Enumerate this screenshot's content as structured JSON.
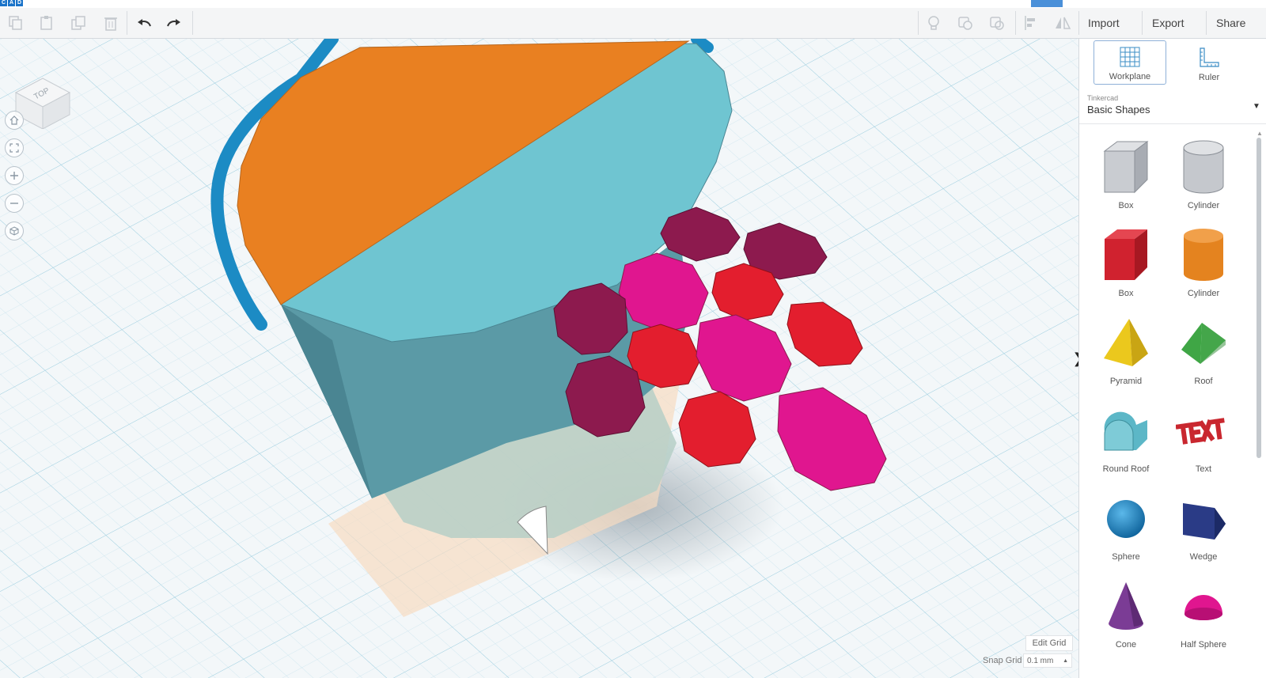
{
  "brand": {
    "logo_letters": [
      "C",
      "A",
      "D"
    ]
  },
  "toolbar": {
    "icons": [
      "copy-icon",
      "paste-icon",
      "duplicate-icon",
      "delete-icon",
      "undo-icon",
      "redo-icon",
      "note-icon",
      "group-icon",
      "ungroup-icon",
      "align-icon",
      "mirror-icon"
    ],
    "import_label": "Import",
    "export_label": "Export",
    "share_label": "Share"
  },
  "viewport": {
    "navcube_face_label": "TOP",
    "nav_controls": [
      "home-icon",
      "fit-view-icon",
      "zoom-in-icon",
      "zoom-out-icon",
      "perspective-icon"
    ],
    "edit_grid_label": "Edit Grid",
    "snap_grid_label": "Snap Grid",
    "snap_grid_value": "0.1 mm",
    "collapse_glyph": "❯"
  },
  "panel": {
    "tools": [
      {
        "label": "Workplane",
        "active": true
      },
      {
        "label": "Ruler",
        "active": false
      }
    ],
    "library_brand": "Tinkercad",
    "library_title": "Basic Shapes",
    "shapes": [
      {
        "label": "Box",
        "color": "#b9bdc4"
      },
      {
        "label": "Cylinder",
        "color": "#b9bdc4"
      },
      {
        "label": "Box",
        "color": "#d0222f"
      },
      {
        "label": "Cylinder",
        "color": "#e4831f"
      },
      {
        "label": "Pyramid",
        "color": "#ebc81d"
      },
      {
        "label": "Roof",
        "color": "#3fa645"
      },
      {
        "label": "Round Roof",
        "color": "#5cb7c7"
      },
      {
        "label": "Text",
        "color": "#c9272f"
      },
      {
        "label": "Sphere",
        "color": "#1e8dd1"
      },
      {
        "label": "Wedge",
        "color": "#2a3b86"
      },
      {
        "label": "Cone",
        "color": "#7b3c95"
      },
      {
        "label": "Half Sphere",
        "color": "#e0168f"
      }
    ]
  },
  "colors": {
    "bucket_lid": "#e98021",
    "bucket_body": "#6fc5d1",
    "bucket_handle": "#1c8bc4",
    "flower_dark": "#8d1a4e",
    "flower_red": "#e31e2e",
    "flower_magenta": "#e0168f"
  }
}
